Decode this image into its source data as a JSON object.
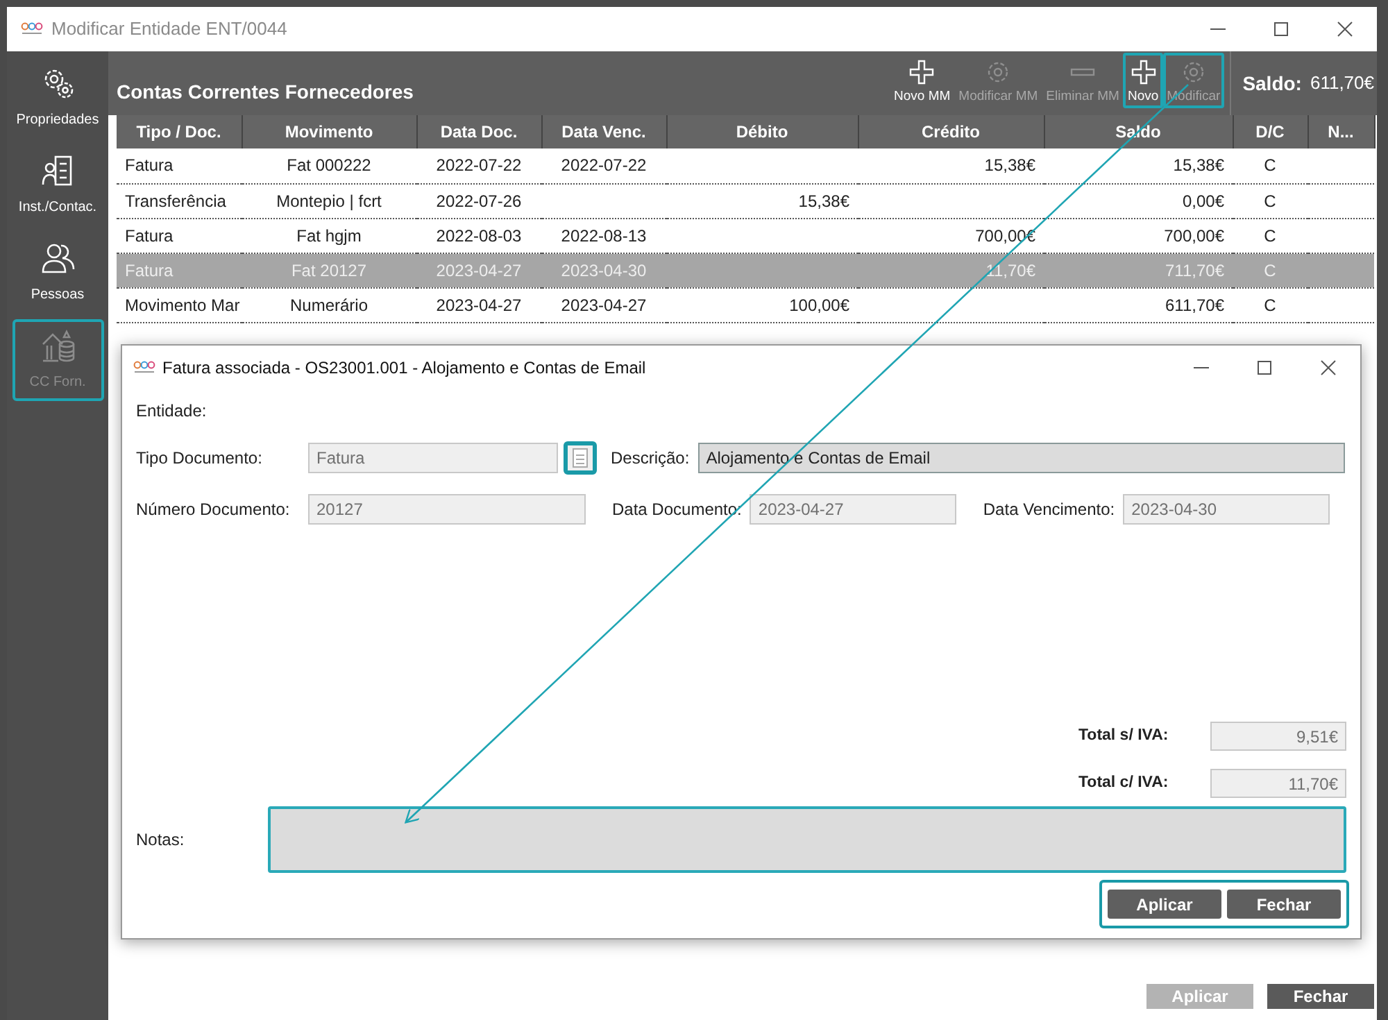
{
  "window": {
    "title": "Modificar Entidade ENT/0044"
  },
  "sidebar": {
    "items": [
      {
        "label": "Propriedades",
        "kind": "gear",
        "disabled": false,
        "highlighted": false
      },
      {
        "label": "Inst./Contac.",
        "kind": "building",
        "disabled": false,
        "highlighted": false
      },
      {
        "label": "Pessoas",
        "kind": "people",
        "disabled": false,
        "highlighted": false
      },
      {
        "label": "CC Forn.",
        "kind": "coins",
        "disabled": true,
        "highlighted": true
      }
    ]
  },
  "section_title": "Contas Correntes Fornecedores",
  "toolbar": {
    "buttons": [
      {
        "label": "Novo MM",
        "kind": "add",
        "disabled": false,
        "highlighted": false
      },
      {
        "label": "Modificar MM",
        "kind": "edit",
        "disabled": true,
        "highlighted": false
      },
      {
        "label": "Eliminar MM",
        "kind": "remove",
        "disabled": true,
        "highlighted": false
      },
      {
        "label": "Novo",
        "kind": "add",
        "disabled": false,
        "highlighted": true
      },
      {
        "label": "Modificar",
        "kind": "edit",
        "disabled": true,
        "highlighted": true
      }
    ]
  },
  "balance": {
    "label": "Saldo:",
    "value": "611,70€"
  },
  "table": {
    "columns": [
      "Tipo / Doc.",
      "Movimento",
      "Data Doc.",
      "Data Venc.",
      "Débito",
      "Crédito",
      "Saldo",
      "D/C",
      "N..."
    ],
    "rows": [
      {
        "type": "Fatura",
        "movement": "Fat 000222",
        "doc_date": "2022-07-22",
        "due_date": "2022-07-22",
        "credit": "15,38€",
        "balance": "15,38€",
        "dc": "C",
        "selected": false
      },
      {
        "type": "Transferência",
        "movement": "Montepio | fcrt",
        "doc_date": "2022-07-26",
        "debit": "15,38€",
        "balance": "0,00€",
        "dc": "C",
        "selected": false
      },
      {
        "type": "Fatura",
        "movement": "Fat hgjm",
        "doc_date": "2022-08-03",
        "due_date": "2022-08-13",
        "credit": "700,00€",
        "balance": "700,00€",
        "dc": "C",
        "selected": false
      },
      {
        "type": "Fatura",
        "movement": "Fat 20127",
        "doc_date": "2023-04-27",
        "due_date": "2023-04-30",
        "credit": "11,70€",
        "balance": "711,70€",
        "dc": "C",
        "selected": true
      },
      {
        "type": "Movimento Mar",
        "movement": "Numerário",
        "doc_date": "2023-04-27",
        "due_date": "2023-04-27",
        "debit": "100,00€",
        "balance": "611,70€",
        "dc": "C",
        "selected": false
      }
    ]
  },
  "dialog": {
    "title": "Fatura associada - OS23001.001 - Alojamento e Contas de Email",
    "entity": {
      "label": "Entidade:"
    },
    "document_type": {
      "label": "Tipo Documento:",
      "value": "Fatura",
      "disabled": true,
      "lookup_highlighted": true
    },
    "description": {
      "label": "Descrição:",
      "value": "Alojamento e Contas de Email",
      "disabled": false
    },
    "document_number": {
      "label": "Número Documento:",
      "value": "20127",
      "disabled": true
    },
    "document_date": {
      "label": "Data Documento:",
      "value": "2023-04-27",
      "disabled": true
    },
    "due_date": {
      "label": "Data Vencimento:",
      "value": "2023-04-30",
      "disabled": true
    },
    "totals": [
      {
        "label": "Total s/ IVA:",
        "value": "9,51€"
      },
      {
        "label": "Total c/ IVA:",
        "value": "11,70€"
      }
    ],
    "notes": {
      "label": "Notas:",
      "focused": true
    },
    "buttons": [
      {
        "label": "Aplicar",
        "disabled": false
      },
      {
        "label": "Fechar",
        "disabled": false
      }
    ],
    "buttons_highlighted": true
  },
  "footer": {
    "buttons": [
      {
        "label": "Aplicar",
        "disabled": true
      },
      {
        "label": "Fechar",
        "disabled": false
      }
    ]
  },
  "annotations": [
    {
      "kind": "arrow"
    }
  ]
}
